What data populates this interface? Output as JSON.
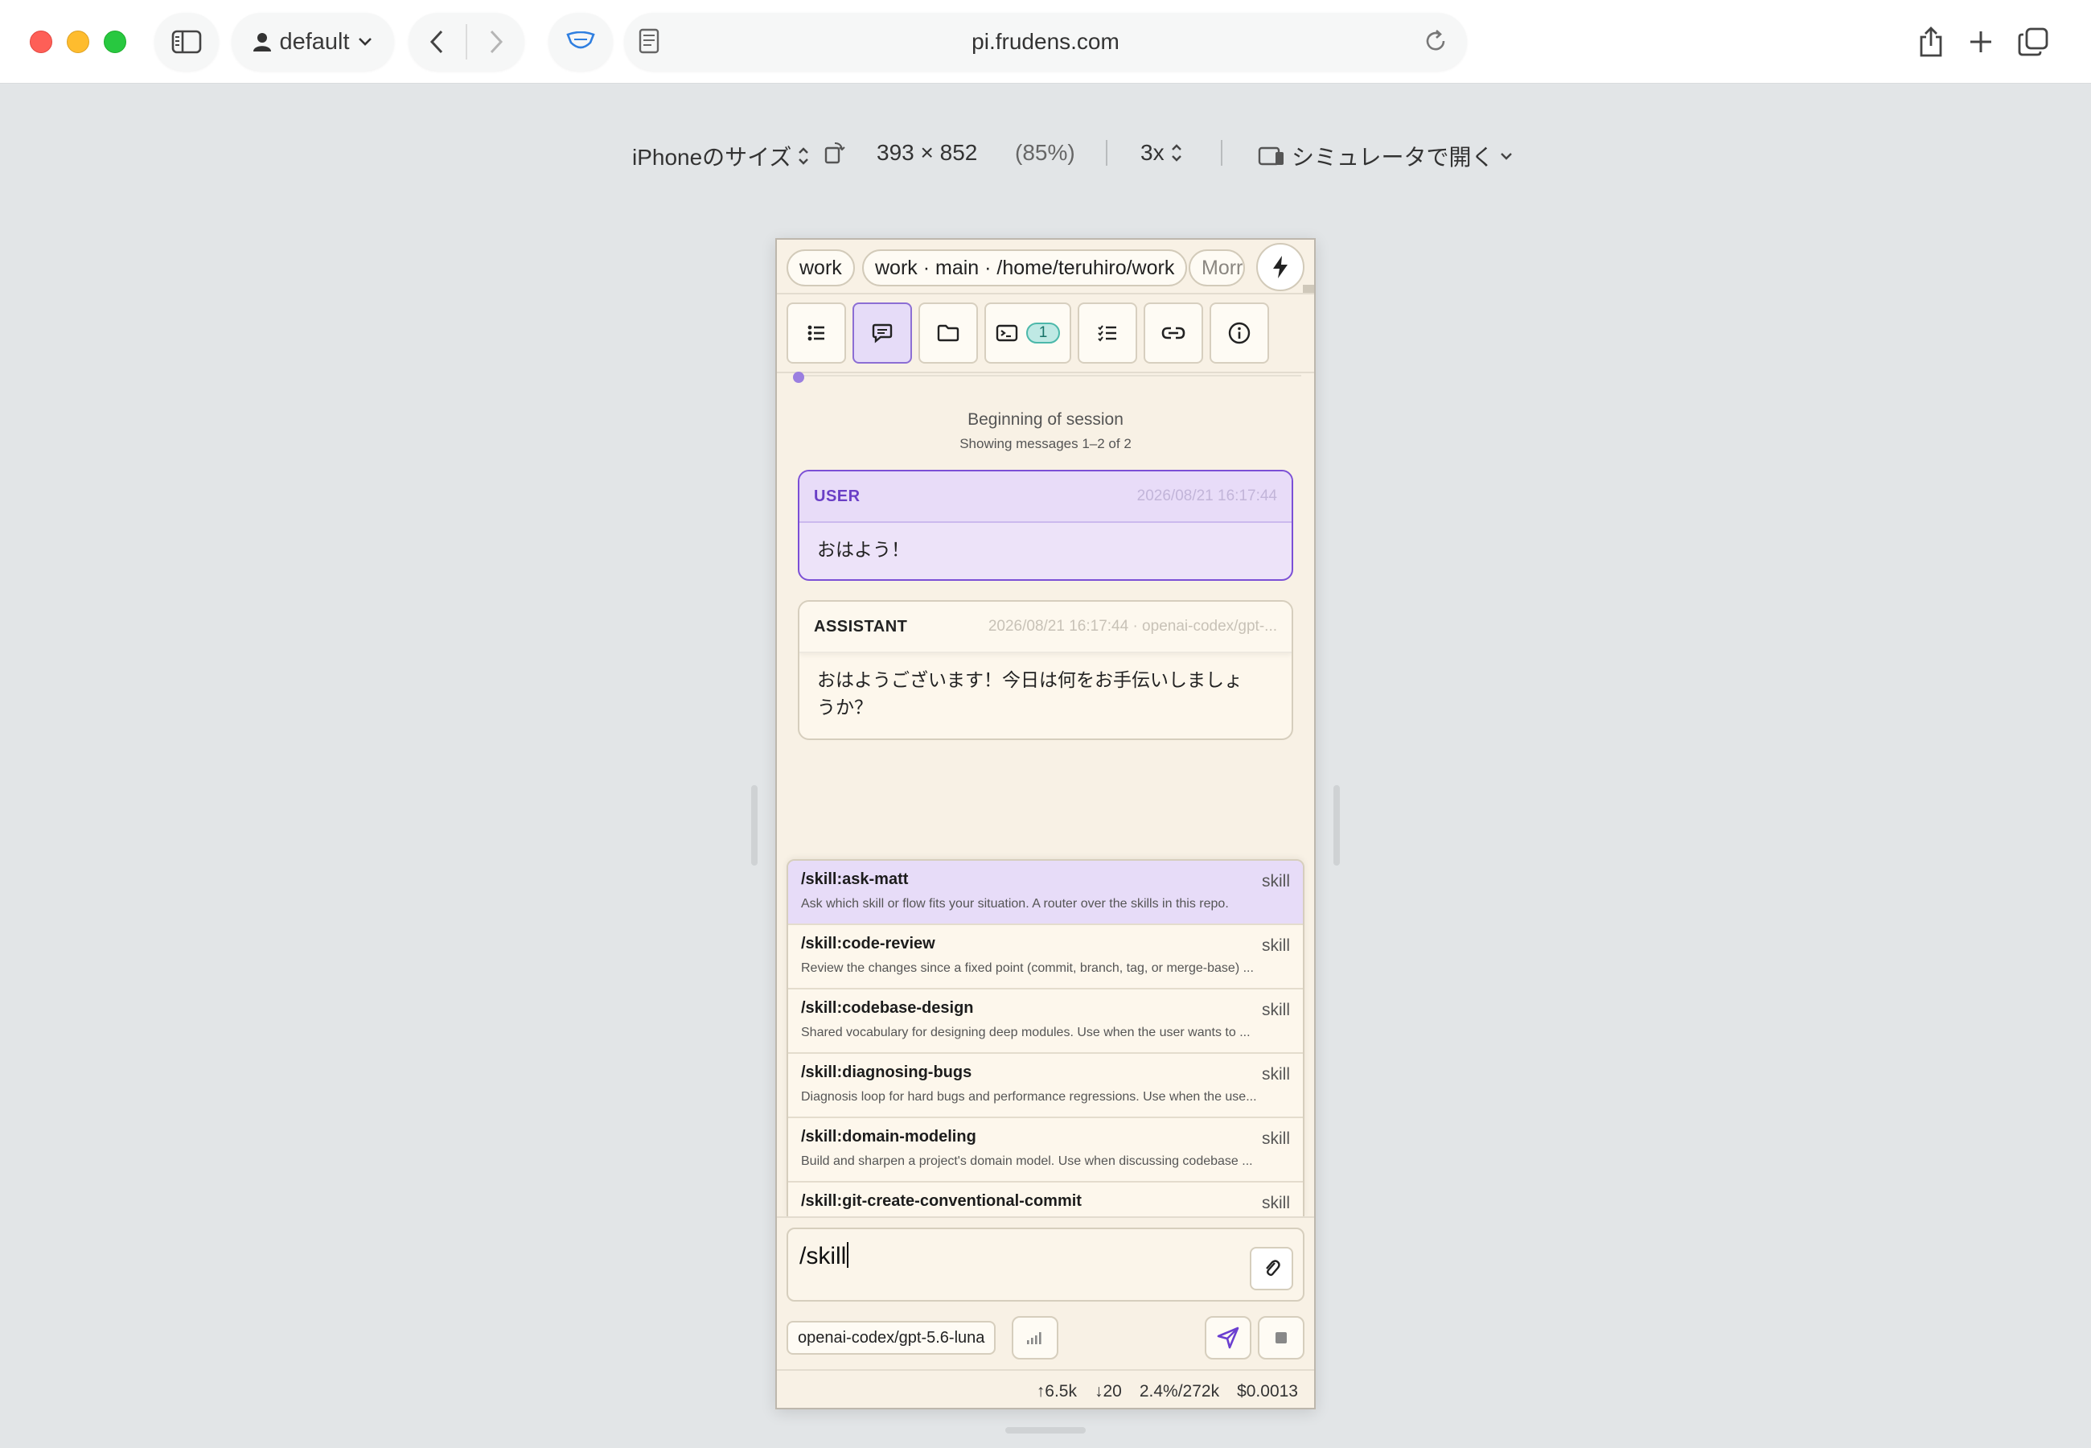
{
  "browser": {
    "profile": "default",
    "url": "pi.frudens.com"
  },
  "rdm": {
    "device": "iPhoneのサイズ",
    "dimensions": "393 × 852",
    "zoom": "(85%)",
    "scale": "3x",
    "open_in": "シミュレータで開く"
  },
  "session_bar": {
    "chips": [
      "work",
      "work · main · /home/teruhiro/work",
      "Morr"
    ]
  },
  "tabs": {
    "terminal_badge": "1"
  },
  "session": {
    "title": "Beginning of session",
    "subtitle": "Showing messages 1–2 of 2"
  },
  "messages": [
    {
      "role": "USER",
      "meta": "2026/08/21 16:17:44",
      "text": "おはよう！"
    },
    {
      "role": "ASSISTANT",
      "meta": "2026/08/21 16:17:44 · openai-codex/gpt-...",
      "text": "おはようございます！今日は何をお手伝いしましょうか？"
    }
  ],
  "suggestions": [
    {
      "cmd": "/skill:ask-matt",
      "type": "skill",
      "desc": "Ask which skill or flow fits your situation. A router over the skills in this repo."
    },
    {
      "cmd": "/skill:code-review",
      "type": "skill",
      "desc": "Review the changes since a fixed point (commit, branch, tag, or merge-base) ..."
    },
    {
      "cmd": "/skill:codebase-design",
      "type": "skill",
      "desc": "Shared vocabulary for designing deep modules. Use when the user wants to ..."
    },
    {
      "cmd": "/skill:diagnosing-bugs",
      "type": "skill",
      "desc": "Diagnosis loop for hard bugs and performance regressions. Use when the use..."
    },
    {
      "cmd": "/skill:domain-modeling",
      "type": "skill",
      "desc": "Build and sharpen a project's domain model. Use when discussing codebase ..."
    },
    {
      "cmd": "/skill:git-create-conventional-commit",
      "type": "skill",
      "desc": ""
    }
  ],
  "composer": {
    "value": "/skill",
    "model": "openai-codex/gpt-5.6-luna"
  },
  "usage": {
    "input": "↑6.5k",
    "output": "↓20",
    "context": "2.4%/272k",
    "cost": "$0.0013"
  },
  "colors": {
    "accent": "#7b4fd6",
    "panel_bg": "#f8f1e5",
    "badge": "#4cb8aa"
  }
}
